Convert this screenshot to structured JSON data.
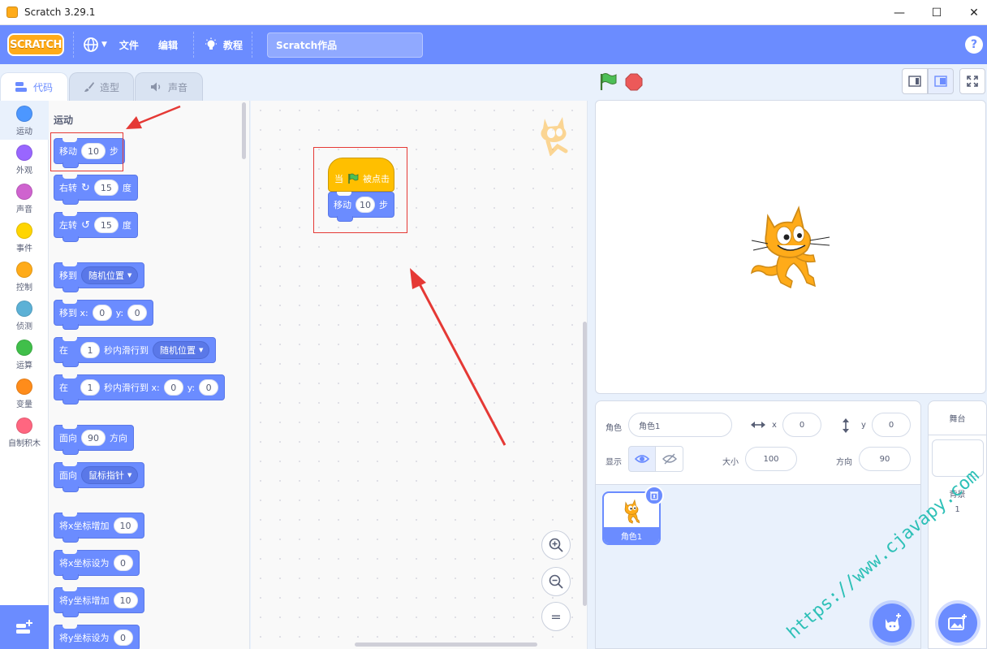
{
  "window": {
    "title": "Scratch 3.29.1",
    "minimize": "—",
    "maximize": "☐",
    "close": "✕"
  },
  "menubar": {
    "logo": "SCRATCH",
    "file": "文件",
    "edit": "编辑",
    "tutorials": "教程",
    "project_title": "Scratch作品",
    "help": "?"
  },
  "tabs": {
    "code": "代码",
    "costumes": "造型",
    "sounds": "声音"
  },
  "categories": [
    {
      "label": "运动",
      "color": "#4c97ff"
    },
    {
      "label": "外观",
      "color": "#9966ff"
    },
    {
      "label": "声音",
      "color": "#cf63cf"
    },
    {
      "label": "事件",
      "color": "#ffd500"
    },
    {
      "label": "控制",
      "color": "#ffab19"
    },
    {
      "label": "侦测",
      "color": "#5cb1d6"
    },
    {
      "label": "运算",
      "color": "#40bf4a"
    },
    {
      "label": "变量",
      "color": "#ff8c1a"
    },
    {
      "label": "自制积木",
      "color": "#ff6680"
    }
  ],
  "palette": {
    "title": "运动",
    "blocks": {
      "move": {
        "text": "移动",
        "value": "10",
        "suffix": "步"
      },
      "turn_right": {
        "text": "右转",
        "value": "15",
        "suffix": "度"
      },
      "turn_left": {
        "text": "左转",
        "value": "15",
        "suffix": "度"
      },
      "goto": {
        "text": "移到",
        "menu": "随机位置"
      },
      "goto_xy": {
        "text": "移到 x:",
        "x": "0",
        "ylabel": "y:",
        "y": "0"
      },
      "glide_to": {
        "text": "在",
        "secs": "1",
        "mid": "秒内滑行到",
        "menu": "随机位置"
      },
      "glide_xy": {
        "text": "在",
        "secs": "1",
        "mid": "秒内滑行到 x:",
        "x": "0",
        "ylabel": "y:",
        "y": "0"
      },
      "point_dir": {
        "text": "面向",
        "value": "90",
        "suffix": "方向"
      },
      "point_towards": {
        "text": "面向",
        "menu": "鼠标指针"
      },
      "change_x": {
        "text": "将x坐标增加",
        "value": "10"
      },
      "set_x": {
        "text": "将x坐标设为",
        "value": "0"
      },
      "change_y": {
        "text": "将y坐标增加",
        "value": "10"
      },
      "set_y": {
        "text": "将y坐标设为",
        "value": "0"
      }
    }
  },
  "script": {
    "hat": {
      "pre": "当",
      "post": "被点击"
    },
    "move": {
      "text": "移动",
      "value": "10",
      "suffix": "步"
    },
    "zoom_in": "+",
    "zoom_out": "−",
    "zoom_reset": "="
  },
  "sprite_info": {
    "sprite_label": "角色",
    "sprite_name": "角色1",
    "x_label": "x",
    "x_value": "0",
    "y_label": "y",
    "y_value": "0",
    "show_label": "显示",
    "size_label": "大小",
    "size_value": "100",
    "direction_label": "方向",
    "direction_value": "90"
  },
  "sprites": [
    {
      "name": "角色1"
    }
  ],
  "stage_panel": {
    "title": "舞台",
    "backdrop_label": "背景",
    "backdrop_count": "1"
  },
  "watermark": "https://www.cjavapy.com",
  "colors": {
    "motion": "#6b8cff",
    "events": "#ffbf00",
    "accent": "#6b8cff",
    "annotation": "#e53935"
  }
}
